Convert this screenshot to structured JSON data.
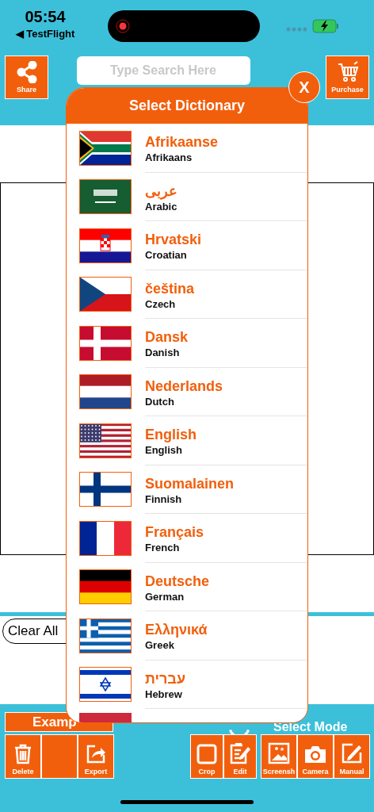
{
  "status_bar": {
    "time": "05:54",
    "back_app": "◀ TestFlight"
  },
  "toolbar": {
    "share": "Share",
    "search": {
      "placeholder": "Type Search Here"
    },
    "purchase": "Purchase"
  },
  "clear_button": "Clear All",
  "example_button": "Examp",
  "mode": {
    "label": "Select Mode"
  },
  "actions_left": [
    {
      "kind": "delete",
      "label": "Delete"
    },
    {
      "kind": "blank"
    },
    {
      "kind": "export",
      "label": "Export"
    }
  ],
  "actions_right": [
    {
      "kind": "crop",
      "label": "Crop"
    },
    {
      "kind": "edit",
      "label": "Edit"
    },
    {
      "kind": "screenshot",
      "label": "Screensh"
    },
    {
      "kind": "camera",
      "label": "Camera"
    },
    {
      "kind": "manual",
      "label": "Manual"
    }
  ],
  "dictionary": {
    "title": "Select Dictionary",
    "close": "X",
    "items": [
      {
        "native": "Afrikaanse",
        "english": "Afrikaans"
      },
      {
        "native": "عربى",
        "english": "Arabic"
      },
      {
        "native": "Hrvatski",
        "english": "Croatian"
      },
      {
        "native": "čeština",
        "english": "Czech"
      },
      {
        "native": "Dansk",
        "english": "Danish"
      },
      {
        "native": "Nederlands",
        "english": "Dutch"
      },
      {
        "native": "English",
        "english": "English"
      },
      {
        "native": "Suomalainen",
        "english": "Finnish"
      },
      {
        "native": "Français",
        "english": "French"
      },
      {
        "native": "Deutsche",
        "english": "German"
      },
      {
        "native": "Ελληνικά",
        "english": "Greek"
      },
      {
        "native": "עברית",
        "english": "Hebrew"
      }
    ]
  }
}
